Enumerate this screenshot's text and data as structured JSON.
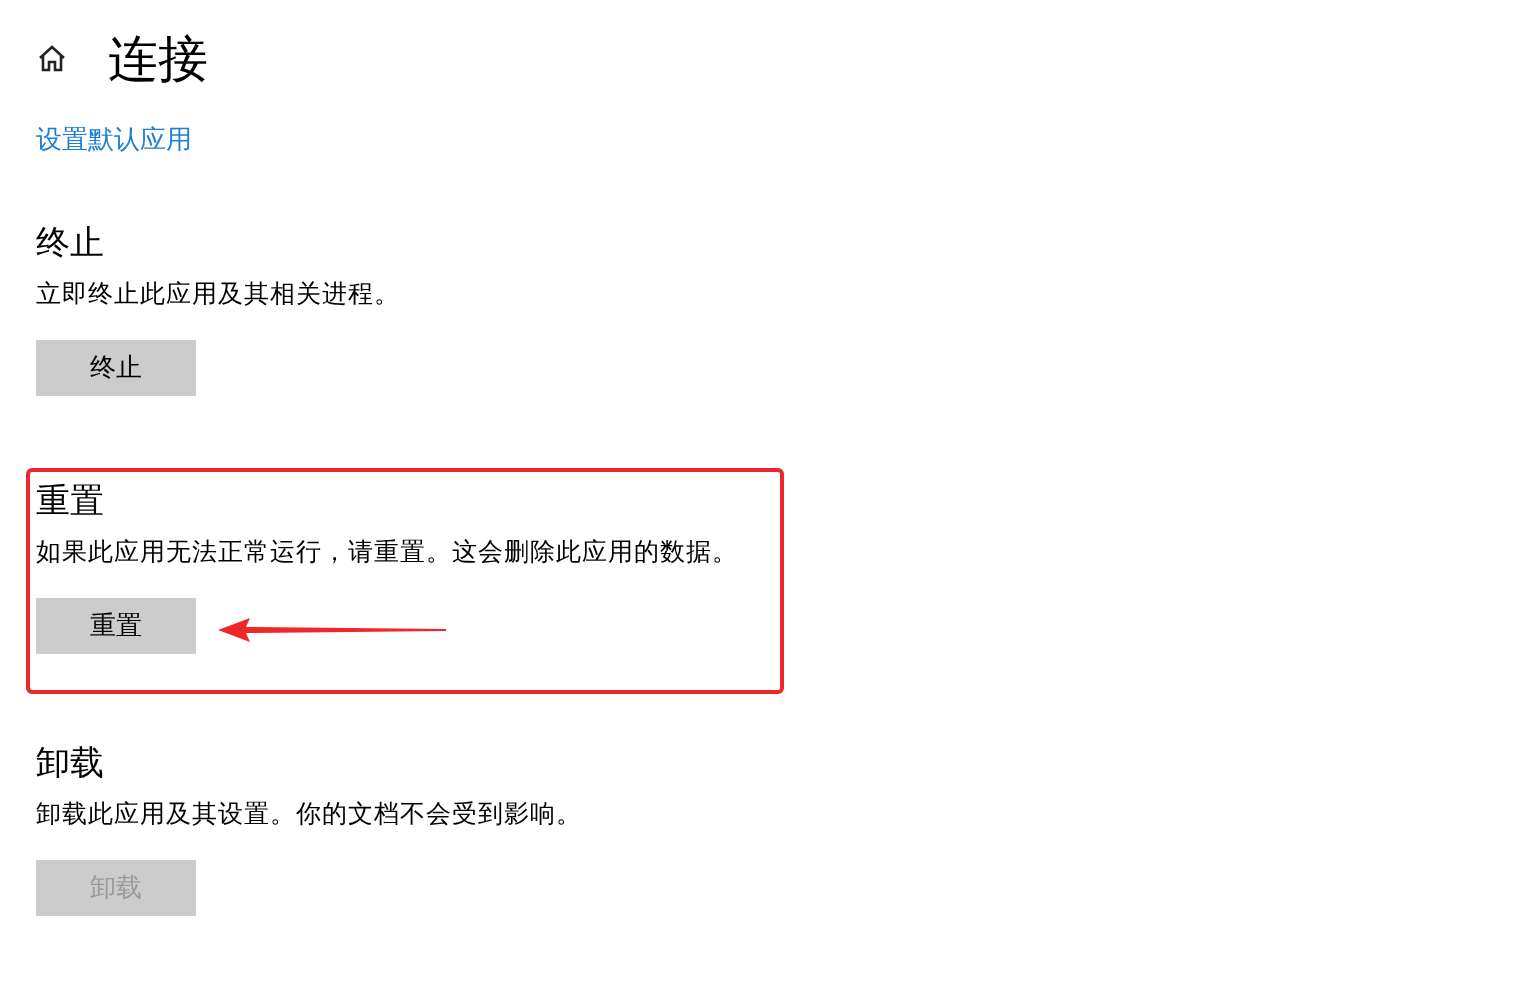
{
  "page": {
    "title": "连接",
    "link": "设置默认应用"
  },
  "sections": [
    {
      "heading": "终止",
      "description": "立即终止此应用及其相关进程。",
      "button": {
        "label": "终止",
        "disabled": false
      },
      "highlighted": false
    },
    {
      "heading": "重置",
      "description": "如果此应用无法正常运行，请重置。这会删除此应用的数据。",
      "button": {
        "label": "重置",
        "disabled": false
      },
      "highlighted": true
    },
    {
      "heading": "卸载",
      "description": "卸载此应用及其设置。你的文档不会受到影响。",
      "button": {
        "label": "卸载",
        "disabled": true
      },
      "highlighted": false
    }
  ]
}
